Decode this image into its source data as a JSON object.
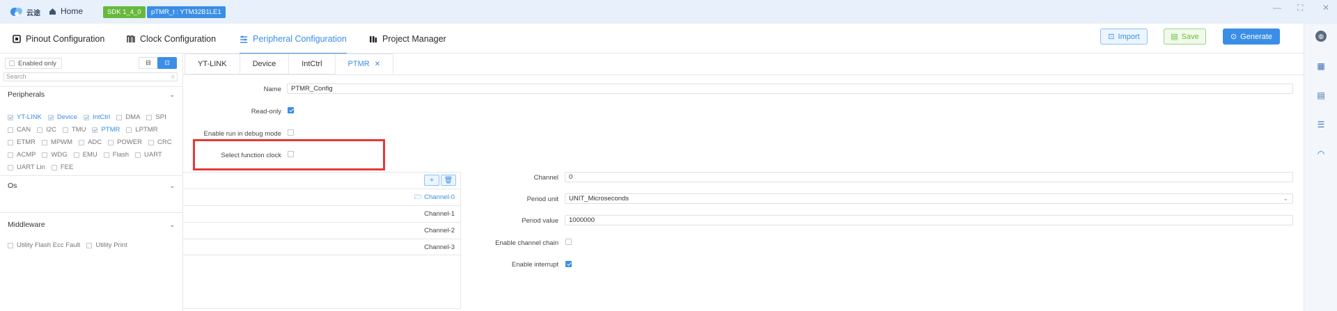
{
  "app": {
    "logo_text": "云途",
    "home_label": "Home",
    "sdk_badge": "SDK 1_4_0",
    "chip_badge": "pTMR_t : YTM32B1LE1"
  },
  "window_controls": [
    "—",
    "⛶",
    "✕"
  ],
  "nav": {
    "items": [
      {
        "label": "Pinout Configuration",
        "icon": "chip-icon"
      },
      {
        "label": "Clock Configuration",
        "icon": "clock-wave-icon"
      },
      {
        "label": "Peripheral Configuration",
        "icon": "peripheral-icon"
      },
      {
        "label": "Project Manager",
        "icon": "project-icon"
      }
    ],
    "active": "Peripheral Configuration",
    "import_label": "Import",
    "save_label": "Save",
    "generate_label": "Generate"
  },
  "sidebar": {
    "enabled_only_label": "Enabled only",
    "search_placeholder": "Search",
    "peripherals_title": "Peripherals",
    "peripherals": [
      [
        {
          "label": "YT-LINK",
          "checked": true
        },
        {
          "label": "Device",
          "checked": true
        },
        {
          "label": "IntCtrl",
          "checked": true
        },
        {
          "label": "DMA",
          "checked": false
        },
        {
          "label": "SPI",
          "checked": false
        }
      ],
      [
        {
          "label": "CAN",
          "checked": false
        },
        {
          "label": "I2C",
          "checked": false
        },
        {
          "label": "TMU",
          "checked": false
        },
        {
          "label": "PTMR",
          "checked": true
        },
        {
          "label": "LPTMR",
          "checked": false
        }
      ],
      [
        {
          "label": "ETMR",
          "checked": false
        },
        {
          "label": "MPWM",
          "checked": false
        },
        {
          "label": "ADC",
          "checked": false
        },
        {
          "label": "POWER",
          "checked": false
        },
        {
          "label": "CRC",
          "checked": false
        }
      ],
      [
        {
          "label": "ACMP",
          "checked": false
        },
        {
          "label": "WDG",
          "checked": false
        },
        {
          "label": "EMU",
          "checked": false
        },
        {
          "label": "Flash",
          "checked": false
        },
        {
          "label": "UART",
          "checked": false
        }
      ],
      [
        {
          "label": "UART Lin",
          "checked": false
        },
        {
          "label": "FEE",
          "checked": false
        }
      ]
    ],
    "os_title": "Os",
    "middleware_title": "Middleware",
    "middleware": [
      {
        "label": "Utility Flash Ecc Fault",
        "checked": false
      },
      {
        "label": "Utility Print",
        "checked": false
      }
    ]
  },
  "tabs": [
    {
      "label": "YT-LINK"
    },
    {
      "label": "Device"
    },
    {
      "label": "IntCtrl"
    },
    {
      "label": "PTMR",
      "active": true
    }
  ],
  "form": {
    "name_label": "Name",
    "name_value": "PTMR_Config",
    "readonly_label": "Read-only",
    "readonly_checked": true,
    "debug_label": "Enable run in debug mode",
    "debug_checked": false,
    "func_clock_label": "Select function clock",
    "func_clock_checked": false
  },
  "channels": {
    "rows": [
      "Channel-0",
      "Channel-1",
      "Channel-2",
      "Channel-3"
    ],
    "active": "Channel-0",
    "add_icon": "plus-icon",
    "delete_icon": "trash-icon"
  },
  "channel_form": {
    "channel_label": "Channel",
    "channel_value": "0",
    "period_unit_label": "Period unit",
    "period_unit_value": "UNIT_Microseconds",
    "period_value_label": "Period value",
    "period_value_value": "1000000",
    "chain_label": "Enable channel chain",
    "chain_checked": false,
    "interrupt_label": "Enable interrupt",
    "interrupt_checked": true
  },
  "colors": {
    "accent": "#3a8ee6",
    "success": "#67b93e",
    "highlight": "#e53935"
  }
}
